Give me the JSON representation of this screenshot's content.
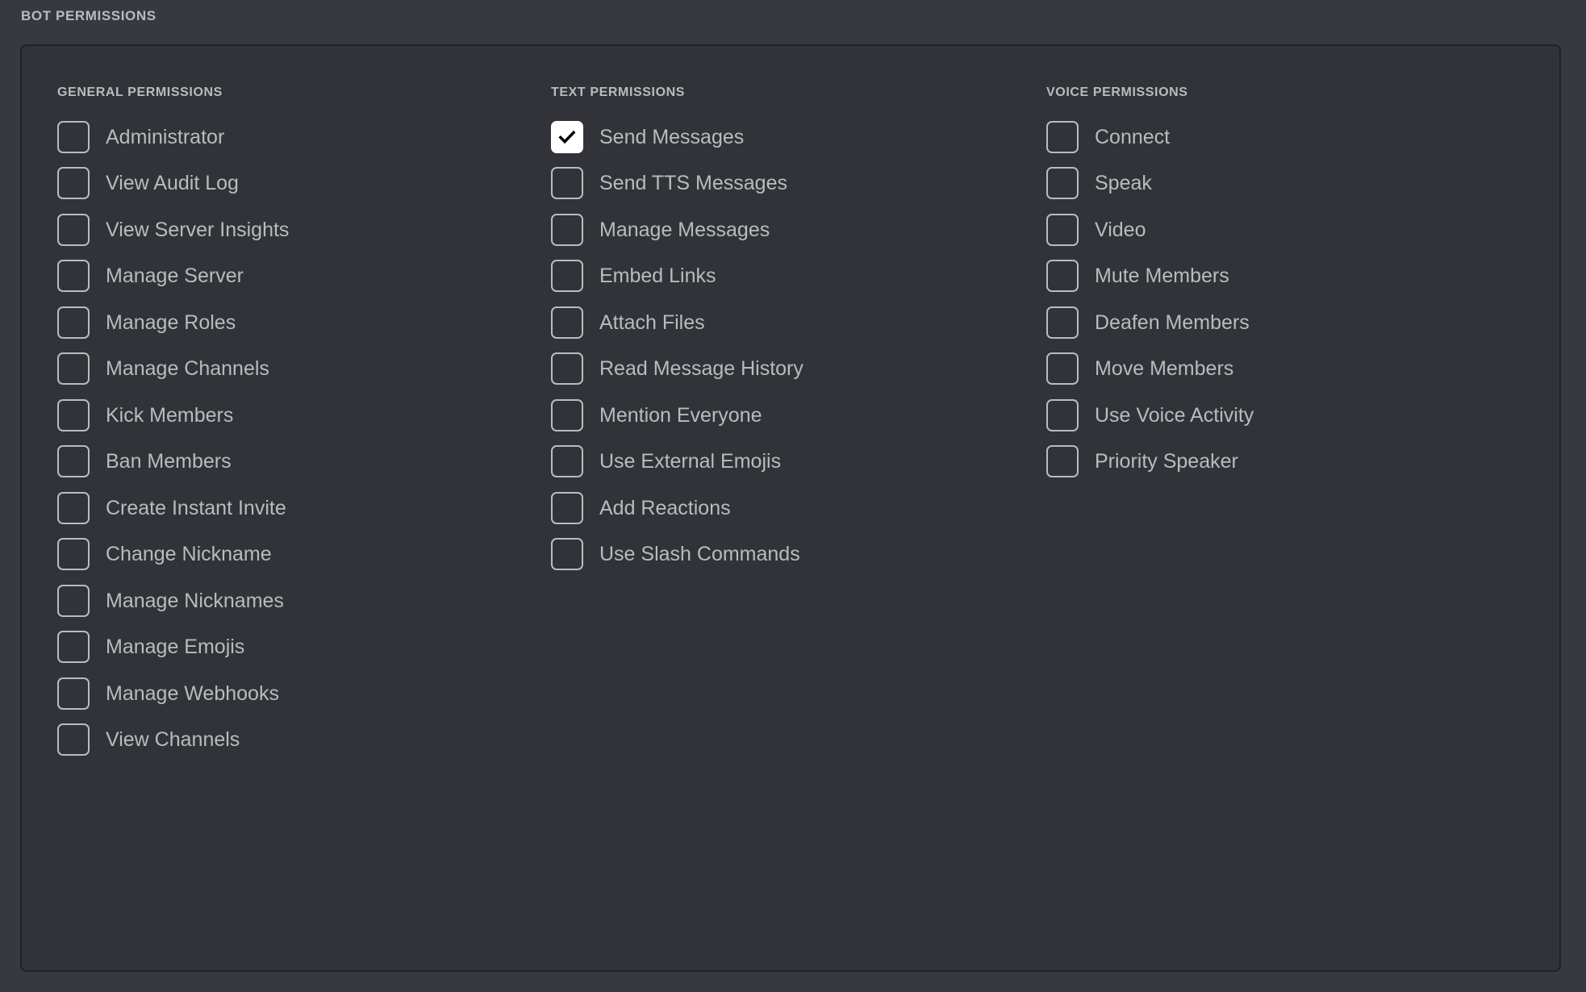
{
  "section": {
    "title": "BOT PERMISSIONS"
  },
  "colors": {
    "page_background": "#36393f",
    "panel_background": "#313338",
    "panel_border": "#202225",
    "text": "#b9bbbe",
    "checkbox_border": "#b9bbbe",
    "checkbox_checked_fill": "#ffffff",
    "checkmark": "#000000"
  },
  "columns": [
    {
      "key": "general",
      "header": "GENERAL PERMISSIONS",
      "items": [
        {
          "label": "Administrator",
          "checked": false
        },
        {
          "label": "View Audit Log",
          "checked": false
        },
        {
          "label": "View Server Insights",
          "checked": false
        },
        {
          "label": "Manage Server",
          "checked": false
        },
        {
          "label": "Manage Roles",
          "checked": false
        },
        {
          "label": "Manage Channels",
          "checked": false
        },
        {
          "label": "Kick Members",
          "checked": false
        },
        {
          "label": "Ban Members",
          "checked": false
        },
        {
          "label": "Create Instant Invite",
          "checked": false
        },
        {
          "label": "Change Nickname",
          "checked": false
        },
        {
          "label": "Manage Nicknames",
          "checked": false
        },
        {
          "label": "Manage Emojis",
          "checked": false
        },
        {
          "label": "Manage Webhooks",
          "checked": false
        },
        {
          "label": "View Channels",
          "checked": false
        }
      ]
    },
    {
      "key": "text",
      "header": "TEXT PERMISSIONS",
      "items": [
        {
          "label": "Send Messages",
          "checked": true
        },
        {
          "label": "Send TTS Messages",
          "checked": false
        },
        {
          "label": "Manage Messages",
          "checked": false
        },
        {
          "label": "Embed Links",
          "checked": false
        },
        {
          "label": "Attach Files",
          "checked": false
        },
        {
          "label": "Read Message History",
          "checked": false
        },
        {
          "label": "Mention Everyone",
          "checked": false
        },
        {
          "label": "Use External Emojis",
          "checked": false
        },
        {
          "label": "Add Reactions",
          "checked": false
        },
        {
          "label": "Use Slash Commands",
          "checked": false
        }
      ]
    },
    {
      "key": "voice",
      "header": "VOICE PERMISSIONS",
      "items": [
        {
          "label": "Connect",
          "checked": false
        },
        {
          "label": "Speak",
          "checked": false
        },
        {
          "label": "Video",
          "checked": false
        },
        {
          "label": "Mute Members",
          "checked": false
        },
        {
          "label": "Deafen Members",
          "checked": false
        },
        {
          "label": "Move Members",
          "checked": false
        },
        {
          "label": "Use Voice Activity",
          "checked": false
        },
        {
          "label": "Priority Speaker",
          "checked": false
        }
      ]
    }
  ]
}
